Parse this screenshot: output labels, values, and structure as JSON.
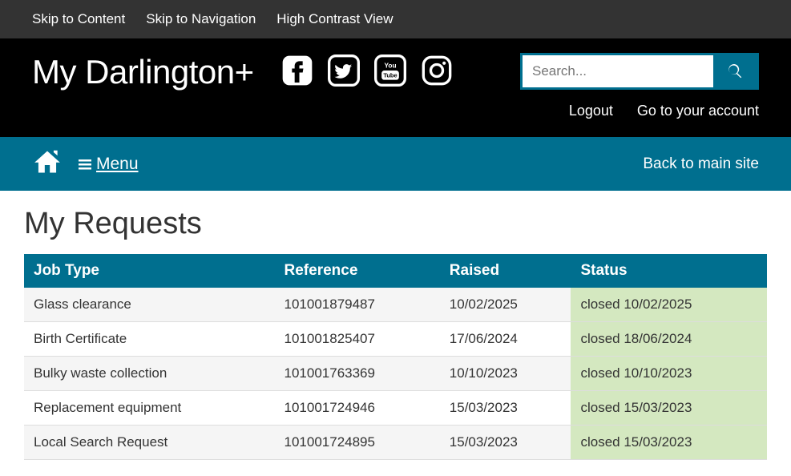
{
  "skip": {
    "content": "Skip to Content",
    "navigation": "Skip to Navigation",
    "contrast": "High Contrast View"
  },
  "site": {
    "title": "My Darlington+"
  },
  "search": {
    "placeholder": "Search..."
  },
  "account": {
    "logout": "Logout",
    "go": "Go to your account"
  },
  "nav": {
    "menu": "Menu",
    "back": "Back to main site"
  },
  "page": {
    "title": "My Requests"
  },
  "table": {
    "headers": {
      "jobType": "Job Type",
      "reference": "Reference",
      "raised": "Raised",
      "status": "Status"
    },
    "rows": [
      {
        "jobType": "Glass clearance",
        "reference": "101001879487",
        "raised": "10/02/2025",
        "status": "closed 10/02/2025"
      },
      {
        "jobType": "Birth Certificate",
        "reference": "101001825407",
        "raised": "17/06/2024",
        "status": "closed 18/06/2024"
      },
      {
        "jobType": "Bulky waste collection",
        "reference": "101001763369",
        "raised": "10/10/2023",
        "status": "closed 10/10/2023"
      },
      {
        "jobType": "Replacement equipment",
        "reference": "101001724946",
        "raised": "15/03/2023",
        "status": "closed 15/03/2023"
      },
      {
        "jobType": "Local Search Request",
        "reference": "101001724895",
        "raised": "15/03/2023",
        "status": "closed 15/03/2023"
      }
    ]
  }
}
